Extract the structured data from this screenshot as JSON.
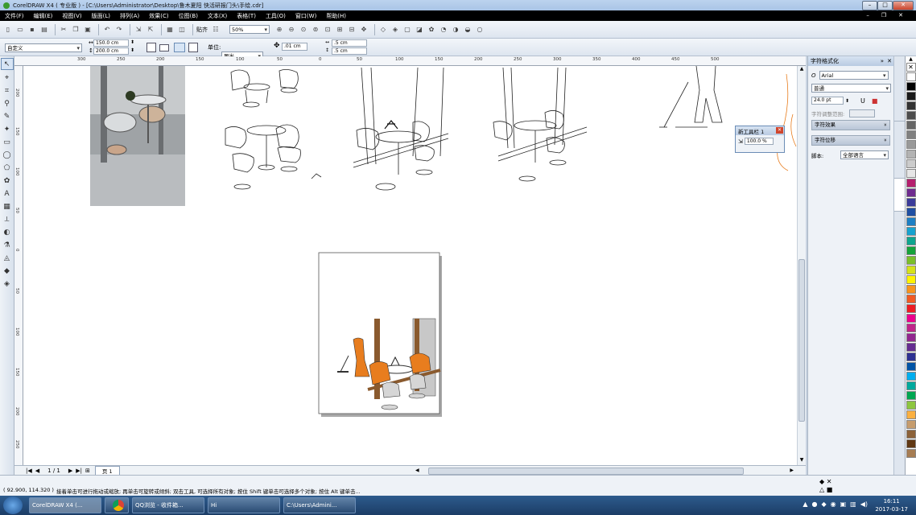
{
  "window": {
    "title": "CorelDRAW X4 ( 专业版 ) - [C:\\Users\\Administrator\\Desktop\\鲁木夏阳 快活研报门头\\手绘.cdr]"
  },
  "menu": [
    "文件(F)",
    "编辑(E)",
    "视图(V)",
    "版面(L)",
    "排列(A)",
    "效果(C)",
    "位图(B)",
    "文本(X)",
    "表格(T)",
    "工具(O)",
    "窗口(W)",
    "帮助(H)"
  ],
  "toolbar1": {
    "zoom": "50%",
    "snap": "贴齐"
  },
  "toolbar2": {
    "preset": "自定义",
    "width": "150.0 cm",
    "height": "200.0 cm",
    "units_label": "单位:",
    "units": "厘米",
    "nudge": ".01 cm",
    "dup_x": ".5 cm",
    "dup_y": ".5 cm"
  },
  "hruler": [
    "300",
    "250",
    "200",
    "150",
    "100",
    "50",
    "0",
    "50",
    "100",
    "150",
    "200",
    "250",
    "300",
    "350",
    "400",
    "450",
    "500"
  ],
  "vruler": [
    "200",
    "150",
    "100",
    "50",
    "0",
    "50",
    "100",
    "150",
    "200",
    "250",
    "300",
    "350"
  ],
  "floating_toolbar": {
    "title": "新工具栏 1",
    "value": "100.0 %"
  },
  "docker": {
    "title": "字符格式化",
    "font": "Arial",
    "style": "普通",
    "size": "24.0 pt",
    "range_label": "字符调整范围:",
    "sections": [
      "字符效果",
      "字符位移"
    ],
    "script_label": "脚本:",
    "script": "全部语言"
  },
  "page_nav": {
    "count": "1 / 1",
    "tab": "页 1"
  },
  "status": {
    "coords": "( 92.900, 114.320 )",
    "hint": "接着单击可进行拖动或缩放; 再单击可旋转或倾斜; 双击工具, 可选择所有对象; 按住 Shift 键单击可选择多个对象; 按住 Alt 键单击..."
  },
  "taskbar": {
    "items": [
      "CorelDRAW X4 (...",
      "QQ浏览 - 收件箱...",
      "Hi",
      "C:\\Users\\Admini..."
    ],
    "time": "16:11",
    "date": "2017-03-17"
  },
  "palette": [
    "#ffffff",
    "#000000",
    "#1a1a1a",
    "#333333",
    "#4d4d4d",
    "#666666",
    "#808080",
    "#999999",
    "#b3b3b3",
    "#cccccc",
    "#e6e6e6",
    "#b51f6d",
    "#6f2c8f",
    "#3b3b9a",
    "#1f4fa3",
    "#1d7fc4",
    "#17a2cf",
    "#0fa58f",
    "#16a33b",
    "#7bbf2a",
    "#d5e11a",
    "#fff200",
    "#f7941d",
    "#f15a24",
    "#ed1c24",
    "#ec008c",
    "#c0258a",
    "#92278f",
    "#662d91",
    "#2e3192",
    "#0054a6",
    "#00aeef",
    "#00a99d",
    "#00a651",
    "#8dc63f",
    "#fbb040",
    "#c69c6d",
    "#8c6239",
    "#603813",
    "#a67c52"
  ],
  "colors": {
    "accent_orange": "#e87d1e",
    "selection": "#4a8ad4"
  }
}
